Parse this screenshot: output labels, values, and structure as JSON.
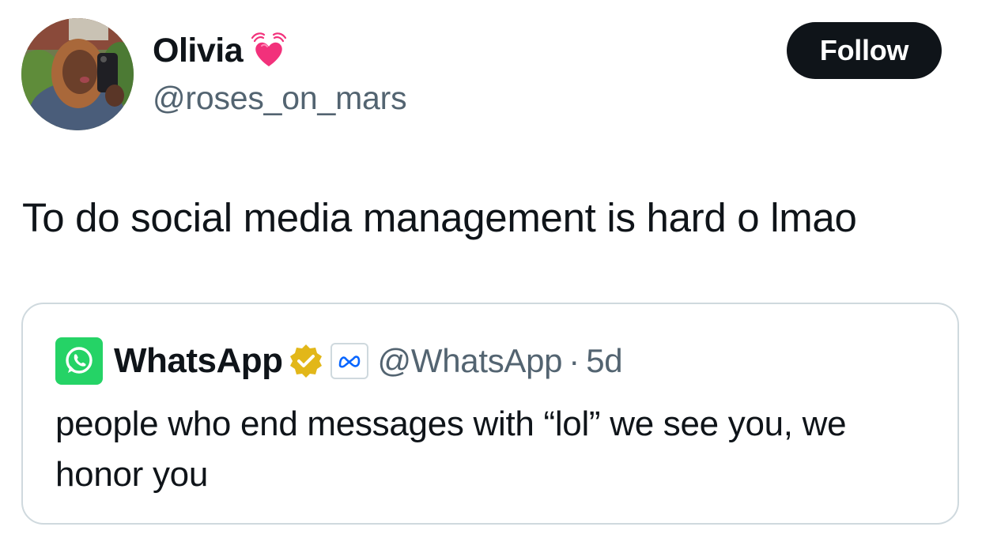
{
  "author": {
    "display_name": "Olivia",
    "name_emoji": "heart-with-waves-icon",
    "handle": "@roses_on_mars",
    "avatar": "avatar-photo"
  },
  "follow_button": {
    "label": "Follow"
  },
  "tweet": {
    "text": "To do social media management is hard o lmao"
  },
  "quoted_tweet": {
    "logo": "whatsapp-logo-icon",
    "display_name": "WhatsApp",
    "verified_badge": "gold-verified-icon",
    "affiliate_badge": "meta-logo-icon",
    "handle": "@WhatsApp",
    "separator": "·",
    "time": "5d",
    "text": "people who end messages with “lol” we see you, we honor you"
  },
  "colors": {
    "text_primary": "#0f1419",
    "text_secondary": "#536471",
    "border": "#cfd9de",
    "follow_bg": "#0f1419",
    "whatsapp_green": "#25d366",
    "verified_gold": "#e2b719",
    "meta_blue": "#0866ff",
    "heart_pink": "#f2317b"
  }
}
